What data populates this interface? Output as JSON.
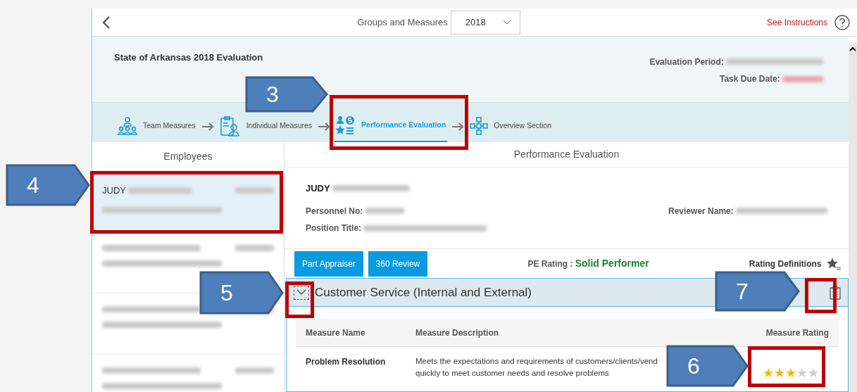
{
  "header": {
    "nav_label": "Groups and Measures",
    "year_select": {
      "value": "2018"
    },
    "instructions_link": "See Instructions"
  },
  "evaluation": {
    "title": "State of Arkansas 2018 Evaluation",
    "period_label": "Evaluation Period:",
    "due_label": "Task Due Date:"
  },
  "steps": [
    {
      "label": "Team Measures",
      "kind": "team",
      "selected": false
    },
    {
      "label": "Individual Measures",
      "kind": "individual",
      "selected": false
    },
    {
      "label": "Performance Evaluation",
      "kind": "performance",
      "selected": true
    },
    {
      "label": "Overview Section",
      "kind": "overview",
      "selected": false
    }
  ],
  "employees_panel": {
    "title": "Employees",
    "employees": [
      {
        "name": "JUDY",
        "selected": true
      },
      {
        "selected": false
      },
      {
        "selected": false
      },
      {
        "selected": false
      }
    ]
  },
  "evaluation_panel": {
    "title": "Performance Evaluation",
    "employee_name": "JUDY",
    "personnel_label": "Personnel No:",
    "position_label": "Position Title:",
    "reviewer_label": "Reviewer Name:",
    "buttons": [
      "Part Appraiser",
      "360 Review"
    ],
    "rating_label": "PE Rating :",
    "rating_value": "Solid Performer",
    "definitions_label": "Rating Definitions",
    "section": {
      "title": "Customer Service (Internal and External)",
      "expanded": true,
      "columns": [
        "Measure Name",
        "Measure Description",
        "Measure Rating"
      ],
      "rows": [
        {
          "name": "Problem Resolution",
          "description_lines": [
            "Meets the expectations and requirements of customers/clients/vend",
            "quickly to meet customer needs and resolve problems"
          ],
          "stars": 3
        }
      ]
    }
  },
  "callouts": [
    {
      "label": "3"
    },
    {
      "label": "4"
    },
    {
      "label": "5"
    },
    {
      "label": "6"
    },
    {
      "label": "7"
    }
  ]
}
